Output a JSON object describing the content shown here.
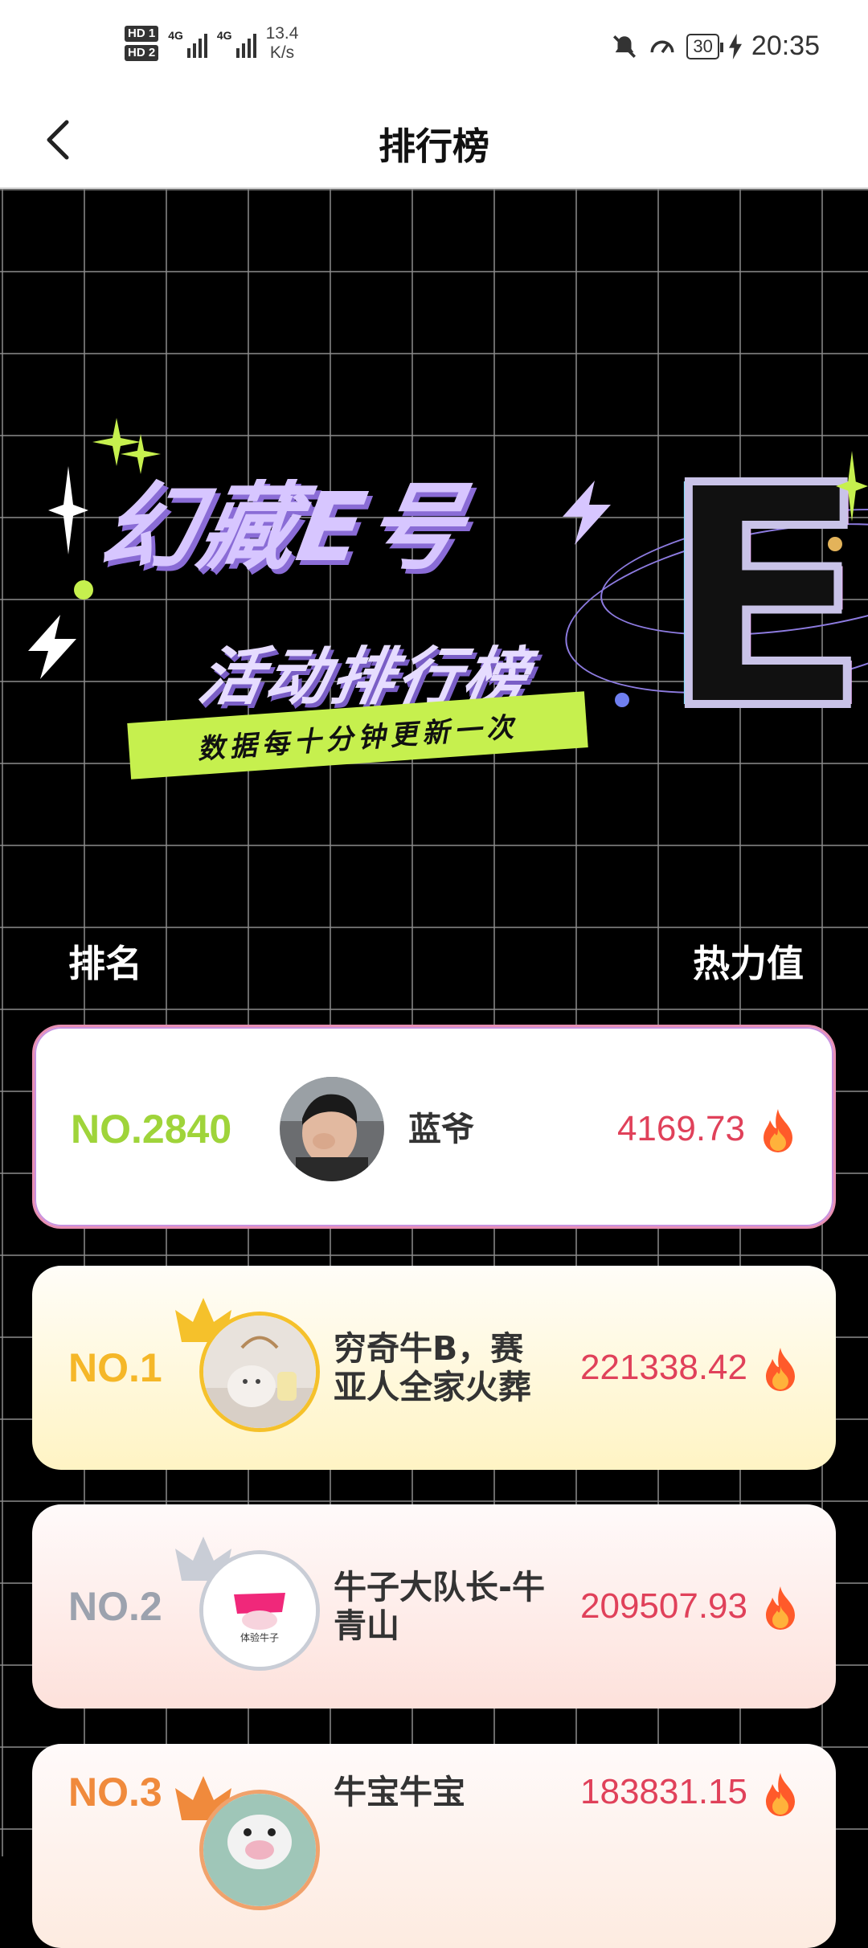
{
  "status_bar": {
    "hd1": "HD 1",
    "hd2": "HD 2",
    "net1": "4G",
    "net2": "4G",
    "speed_value": "13.4",
    "speed_unit": "K/s",
    "battery": "30",
    "time": "20:35"
  },
  "header": {
    "title": "排行榜"
  },
  "banner": {
    "title": "幻藏E号",
    "subtitle": "活动排行榜",
    "ribbon": "数据每十分钟更新一次",
    "big_letter": "E"
  },
  "columns": {
    "rank": "排名",
    "heat": "热力值"
  },
  "my_entry": {
    "rank": "NO.2840",
    "name": "蓝爷",
    "heat": "4169.73"
  },
  "entries": [
    {
      "rank": "NO.1",
      "name": "穷奇牛B，赛亚人全家火葬",
      "heat": "221338.42",
      "color": "#f5b728"
    },
    {
      "rank": "NO.2",
      "name": "牛子大队长-牛青山",
      "heat": "209507.93",
      "color": "#9ca2ae"
    },
    {
      "rank": "NO.3",
      "name": "牛宝牛宝",
      "heat": "183831.15",
      "color": "#f08a3c"
    }
  ],
  "avatar2_text": "体验牛子",
  "colors": {
    "heat": "#e0415a",
    "ribbon": "#c6f04e",
    "banner_text": "#d7c6ff"
  }
}
